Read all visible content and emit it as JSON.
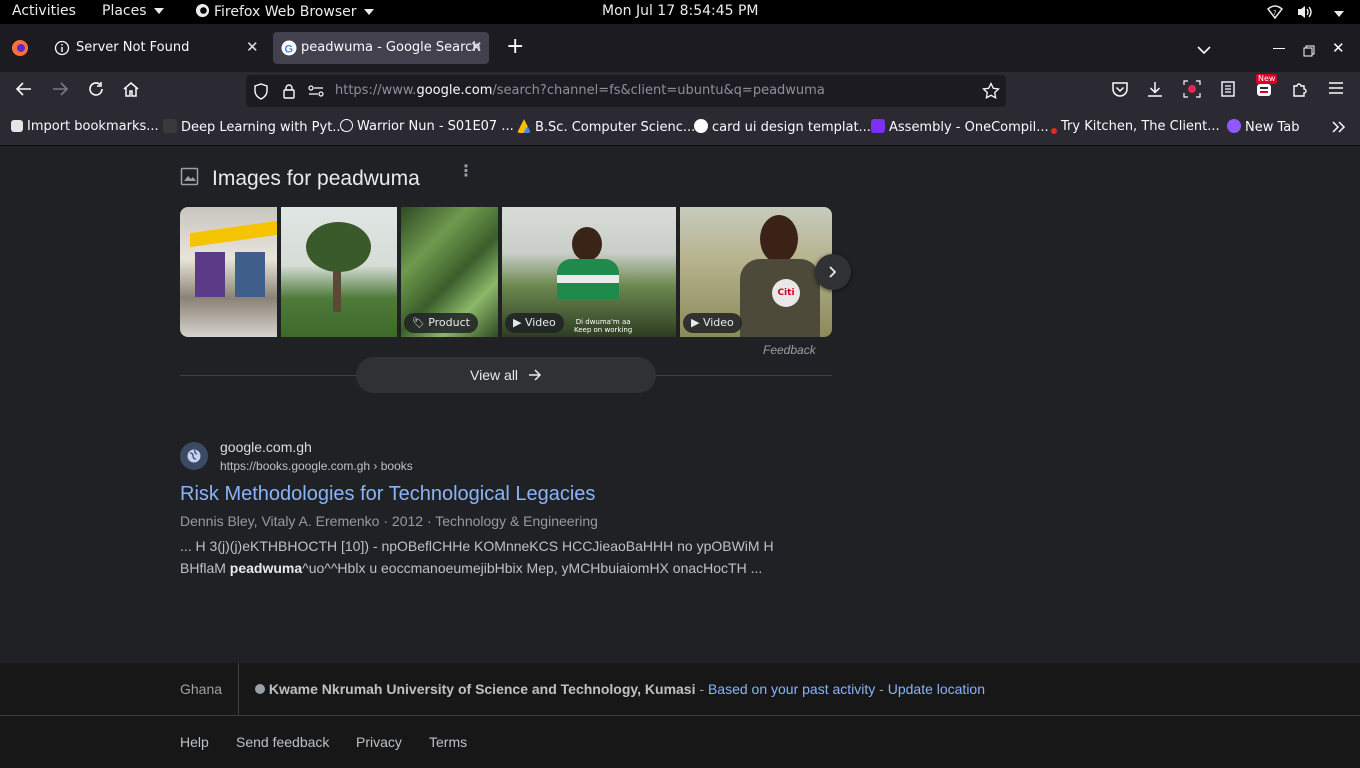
{
  "topbar": {
    "activities": "Activities",
    "places": "Places",
    "app": "Firefox Web Browser",
    "clock": "Mon Jul 17  8:54:45 PM"
  },
  "tabs": [
    {
      "title": "Server Not Found"
    },
    {
      "title": "peadwuma - Google Search"
    }
  ],
  "url": {
    "prefix": "https://www.",
    "domain": "google.com",
    "rest": "/search?channel=fs&client=ubuntu&q=peadwuma"
  },
  "toolbar": {
    "new_badge": "New"
  },
  "bookmarks": [
    {
      "label": "Import bookmarks...",
      "color": "#e5e5e5"
    },
    {
      "label": "Deep Learning with Pyt...",
      "color": "#3a3a3a"
    },
    {
      "label": "Warrior Nun - S01E07 ...",
      "color": "#fbfbfe"
    },
    {
      "label": "B.Sc. Computer Scienc...",
      "color": "#f4b400"
    },
    {
      "label": "card ui design templat...",
      "color": "#4285f4"
    },
    {
      "label": "Assembly - OneCompil...",
      "color": "#7b2ff7"
    },
    {
      "label": "Try Kitchen, The Client...",
      "color": "#d93025"
    },
    {
      "label": "New Tab",
      "color": "#9059ff"
    }
  ],
  "images_section": {
    "heading": "Images for peadwuma",
    "chips": {
      "product": "Product",
      "video1": "Video",
      "video2": "Video"
    },
    "thumb_captions": {
      "t4_line1": "Di dwuma'm aa",
      "t4_line2": "Keep on working",
      "t5_logo": "Citi"
    },
    "feedback": "Feedback",
    "view_all": "View all"
  },
  "result": {
    "site_name": "google.com.gh",
    "site_url": "https://books.google.com.gh › books",
    "title": "Risk Methodologies for Technological Legacies",
    "meta": "Dennis Bley, Vitaly A. Eremenko · 2012 · Technology & Engineering",
    "snippet_line1": "... H 3(j)(j)eKTHBHOCTH [10]) - npOBeflCHHe KOMnneKCS HCCJieaoBaHHH no ypOBWiM H",
    "snippet_pre": "BHflaM ",
    "snippet_bold": "peadwuma",
    "snippet_post": "^uo^^Hblx u eoccmanoeumejibHbix Mep, yMCHbuiaiomHX onacHocTH ..."
  },
  "footer": {
    "country": "Ghana",
    "location": "Kwame Nkrumah University of Science and Technology, Kumasi",
    "sep1": " - ",
    "based_on": "Based on your past activity",
    "sep2": " - ",
    "update": "Update location",
    "links": [
      "Help",
      "Send feedback",
      "Privacy",
      "Terms"
    ]
  }
}
